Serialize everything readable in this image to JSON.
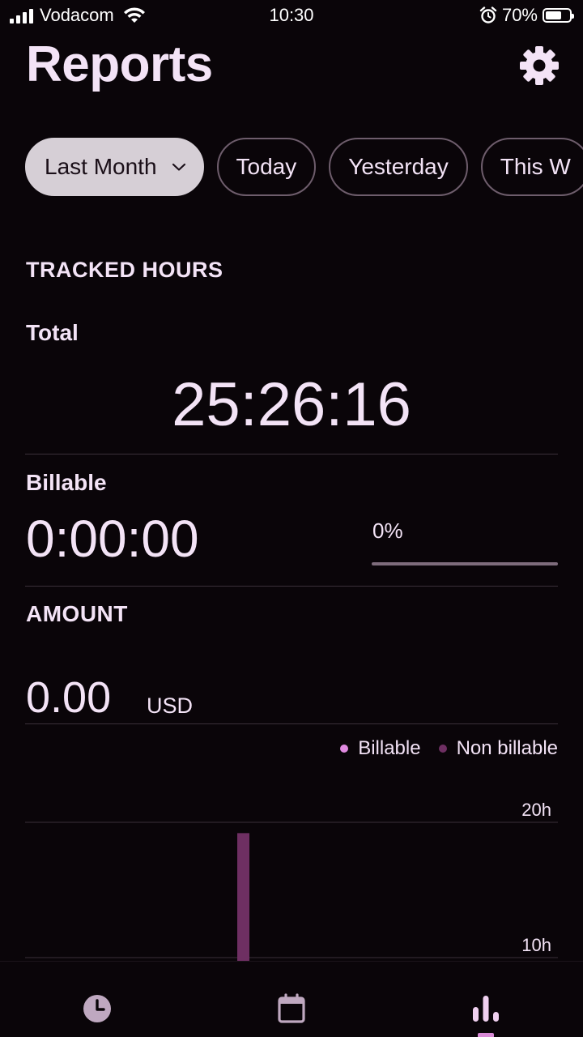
{
  "status_bar": {
    "carrier": "Vodacom",
    "time": "10:30",
    "battery_percent": "70%",
    "battery_level": 0.7,
    "icons": [
      "signal-icon",
      "wifi-icon",
      "alarm-icon",
      "battery-icon"
    ]
  },
  "header": {
    "title": "Reports",
    "settings_icon": "gear-icon"
  },
  "filters": {
    "chips": [
      {
        "label": "Last Month",
        "active": true,
        "dropdown": true
      },
      {
        "label": "Today",
        "active": false
      },
      {
        "label": "Yesterday",
        "active": false
      },
      {
        "label": "This W",
        "active": false
      }
    ]
  },
  "tracked_hours": {
    "heading": "TRACKED HOURS",
    "total_label": "Total",
    "total_value": "25:26:16",
    "billable_label": "Billable",
    "billable_value": "0:00:00",
    "billable_percent_text": "0%",
    "billable_fraction": 0
  },
  "amount": {
    "heading": "AMOUNT",
    "value": "0.00",
    "currency": "USD"
  },
  "legend": {
    "billable": "Billable",
    "non_billable": "Non billable"
  },
  "colors": {
    "background": "#0a0509",
    "text": "#f3e3f6",
    "billable": "#e08ae0",
    "non_billable": "#6e2f62",
    "active_chip": "#d6cfd6",
    "nav_icon_inactive": "#bfa8c0",
    "nav_icon_active": "#f0d0f0"
  },
  "chart_data": {
    "type": "bar",
    "ylim": [
      0,
      20
    ],
    "y_ticks": [
      {
        "value": 20,
        "label": "20h"
      },
      {
        "value": 10,
        "label": "10h"
      }
    ],
    "series": [
      {
        "name": "Non billable",
        "x_index": 11,
        "values_hours": [
          19.2
        ]
      },
      {
        "name": "Billable",
        "values_hours": []
      }
    ],
    "x_slots": 28
  },
  "bottom_nav": {
    "items": [
      {
        "icon": "clock-icon",
        "active": false
      },
      {
        "icon": "calendar-icon",
        "active": false
      },
      {
        "icon": "bar-chart-icon",
        "active": true
      }
    ]
  }
}
